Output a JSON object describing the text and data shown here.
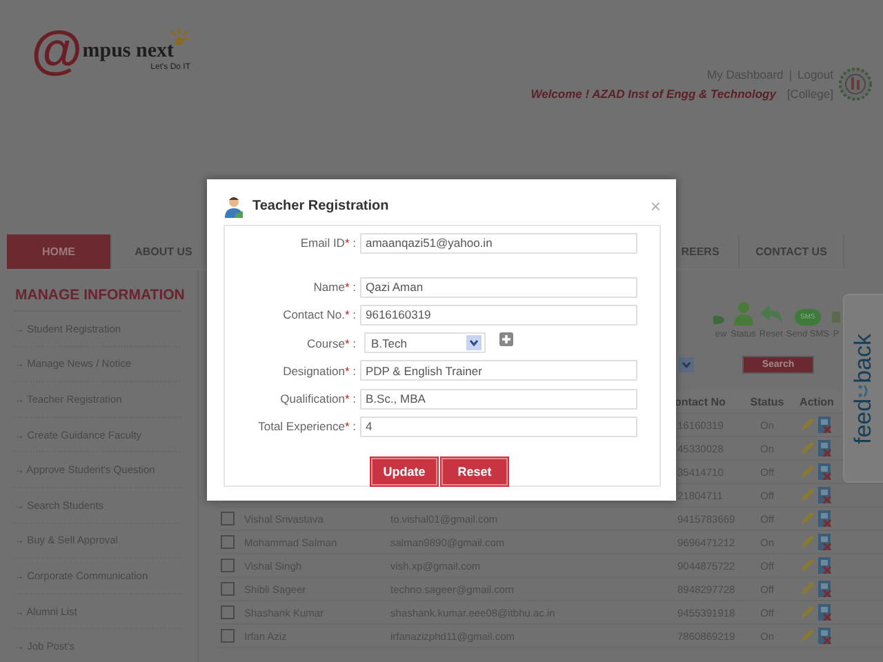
{
  "header": {
    "logo": {
      "mark": "@",
      "name": "mpus next",
      "tagline": "Let's Do IT"
    },
    "links": [
      "My Dashboard",
      "Logout"
    ],
    "link_separator": "|",
    "welcome": "Welcome ! AZAD Inst of Engg & Technology",
    "role": "[College]"
  },
  "nav": {
    "left": [
      {
        "label": "HOME",
        "selected": true
      },
      {
        "label": "ABOUT US",
        "selected": false
      }
    ],
    "right": [
      {
        "label": "REERS",
        "selected": false
      },
      {
        "label": "CONTACT US",
        "selected": false
      }
    ]
  },
  "sidebar": {
    "title": "MANAGE INFORMATION",
    "items": [
      "→ Student Registration",
      "→ Manage News / Notice",
      "→ Teacher Registration",
      "→ Create Guidance Faculty",
      "→ Approve Student's Question",
      "→ Search Students",
      "→ Buy & Sell Approval",
      "→ Corporate Communication",
      "→ Alumni List",
      "→ Job Post's"
    ]
  },
  "toolbar": [
    {
      "kind": "view",
      "label": "ew"
    },
    {
      "kind": "status",
      "label": "Status"
    },
    {
      "kind": "reset",
      "label": "Reset"
    },
    {
      "kind": "sms",
      "label": "Send SMS",
      "badge": "SMS"
    },
    {
      "kind": "print",
      "label": "P"
    }
  ],
  "search_button": "Search",
  "table": {
    "columns": [
      "ontact No",
      "Status",
      "Action"
    ],
    "rows": [
      {
        "contact": "16160319",
        "status": "On"
      },
      {
        "contact": "45330028",
        "status": "On"
      },
      {
        "contact": "35414710",
        "status": "Off"
      },
      {
        "contact": "21804711",
        "status": "Off"
      },
      {
        "checked": false,
        "name": "Vishal Srivastava",
        "email": "to.vishal01@gmail.com",
        "contact": "9415783669",
        "status": "Off"
      },
      {
        "checked": false,
        "name": "Mohammad Salman",
        "email": "salman9890@gmail.com",
        "contact": "9696471212",
        "status": "On"
      },
      {
        "checked": false,
        "name": "Vishal Singh",
        "email": "vish.xp@gmail.com",
        "contact": "9044875722",
        "status": "Off"
      },
      {
        "checked": false,
        "name": "Shibli Sageer",
        "email": "techno.sageer@gmail.com",
        "contact": "8948297728",
        "status": "Off"
      },
      {
        "checked": false,
        "name": "Shashank Kumar",
        "email": "shashank.kumar.eee08@itbhu.ac.in",
        "contact": "9455391918",
        "status": "Off"
      },
      {
        "checked": false,
        "name": "Irfan Aziz",
        "email": "irfanazizphd11@gmail.com",
        "contact": "7860869219",
        "status": "On"
      }
    ]
  },
  "feedback": [
    "feed",
    "back"
  ],
  "dialog": {
    "title": "Teacher Registration",
    "close": "×",
    "fields": [
      {
        "kind": "text",
        "label": "Email ID",
        "mark": "*",
        "sep": " :",
        "value": "amaanqazi51@yahoo.in"
      },
      {
        "kind": "text",
        "label": "Name",
        "mark": "*",
        "sep": " :",
        "value": "Qazi Aman"
      },
      {
        "kind": "text",
        "label": "Contact No.",
        "mark": "*",
        "sep": " :",
        "value": "9616160319"
      },
      {
        "kind": "select",
        "label": "Course",
        "mark": "*",
        "sep": " :",
        "value": "B.Tech"
      },
      {
        "kind": "text",
        "label": "Designation",
        "mark": "*",
        "sep": " :",
        "value": "PDP & English Trainer"
      },
      {
        "kind": "text",
        "label": "Qualification",
        "mark": "*",
        "sep": " :",
        "value": "B.Sc., MBA"
      },
      {
        "kind": "text",
        "label": "Total Experience",
        "mark": "*",
        "sep": " :",
        "value": "4"
      }
    ],
    "buttons": [
      "Update",
      "Reset"
    ]
  }
}
